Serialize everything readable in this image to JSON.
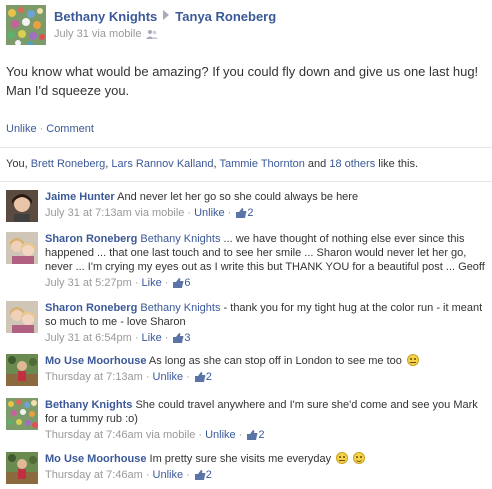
{
  "post": {
    "author": "Bethany Knights",
    "target": "Tanya Roneberg",
    "date": "July 31 via mobile",
    "text": "You know what would be amazing? If you could fly down and give us one last hug! Man I'd squeeze you.",
    "actions": {
      "unlike": "Unlike",
      "comment": "Comment"
    },
    "likes": {
      "prefix": "You, ",
      "names": [
        "Brett Roneberg",
        "Lars Rannov Kalland",
        "Tammie Thornton"
      ],
      "and": " and ",
      "others": "18 others",
      "suffix": " like this."
    }
  },
  "comments": [
    {
      "author": "Jaime Hunter",
      "mention": "",
      "text": "And never let her go so she could always be here",
      "time": "July 31 at 7:13am via mobile",
      "action": "Unlike",
      "likes": "2",
      "emoji": []
    },
    {
      "author": "Sharon Roneberg",
      "mention": "Bethany Knights",
      "text": " ... we have thought of nothing else ever since this happened ... that one last touch and to see her smile ... Sharon would never let her go, never ... I'm crying my eyes out as I write this but THANK YOU for a beautiful post ... Geoff",
      "time": "July 31 at 5:27pm",
      "action": "Like",
      "likes": "6",
      "emoji": []
    },
    {
      "author": "Sharon Roneberg",
      "mention": "Bethany Knights",
      "text": " - thank you for my tight hug at the color run - it meant so much to me - love Sharon",
      "time": "July 31 at 6:54pm",
      "action": "Like",
      "likes": "3",
      "emoji": []
    },
    {
      "author": "Mo Use Moorhouse",
      "mention": "",
      "text": "As long as she can stop off in London to see me too",
      "time": "Thursday at 7:13am",
      "action": "Unlike",
      "likes": "2",
      "emoji": [
        "flat-smiley"
      ]
    },
    {
      "author": "Bethany Knights",
      "mention": "",
      "text": "She could travel anywhere and I'm sure she'd come and see you Mark for a tummy rub :o)",
      "time": "Thursday at 7:46am via mobile",
      "action": "Unlike",
      "likes": "2",
      "emoji": []
    },
    {
      "author": "Mo Use Moorhouse",
      "mention": "",
      "text": "Im pretty sure she visits me everyday",
      "time": "Thursday at 7:46am",
      "action": "Unlike",
      "likes": "2",
      "emoji": [
        "flat-smiley",
        "smiley"
      ]
    }
  ],
  "colors": {
    "link": "#3b5998",
    "meta": "#999999",
    "divider": "#e3e6ed"
  }
}
